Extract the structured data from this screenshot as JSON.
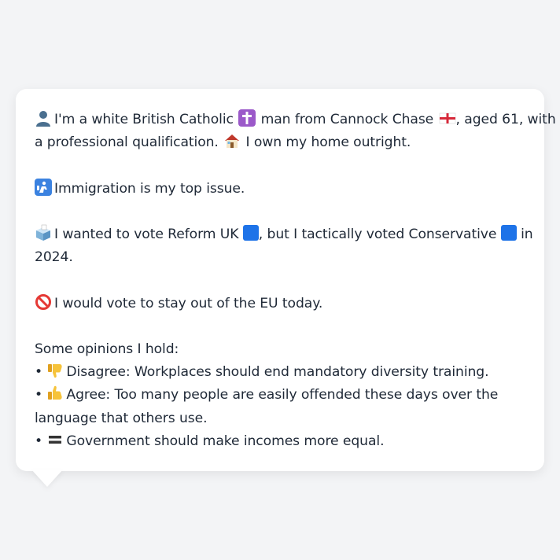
{
  "intro": {
    "text1": "I'm a white British Catholic",
    "text2": "man from Cannock Chase",
    "text3": ", aged 61, with",
    "text4": "a professional qualification.",
    "text5": "I own my home outright."
  },
  "issue": {
    "text": "Immigration is my top issue."
  },
  "vote": {
    "text1": "I wanted to vote Reform UK",
    "text2": ", but I tactically voted Conservative",
    "text3": "in",
    "text4": "2024.",
    "reform_color": "#1e73e8",
    "conservative_color": "#1e73e8"
  },
  "eu": {
    "text": "I would vote to stay out of the EU today."
  },
  "opinions": {
    "heading": "Some opinions I hold:",
    "item1": "Disagree: Workplaces should end mandatory diversity training.",
    "item2_line1": "Agree: Too many people are easily offended these days over the",
    "item2_line2": "language that others use.",
    "item3": "Government should make incomes more equal.",
    "bullet": "•"
  },
  "icons": {
    "person": "person-silhouette-icon",
    "cross": "latin-cross-icon",
    "flag": "england-flag-icon",
    "house": "house-icon",
    "passport": "passport-control-icon",
    "ballot": "ballot-box-icon",
    "no_entry": "prohibited-icon",
    "thumbs_down": "thumbs-down-icon",
    "thumbs_up": "thumbs-up-icon",
    "equals": "equals-icon"
  }
}
